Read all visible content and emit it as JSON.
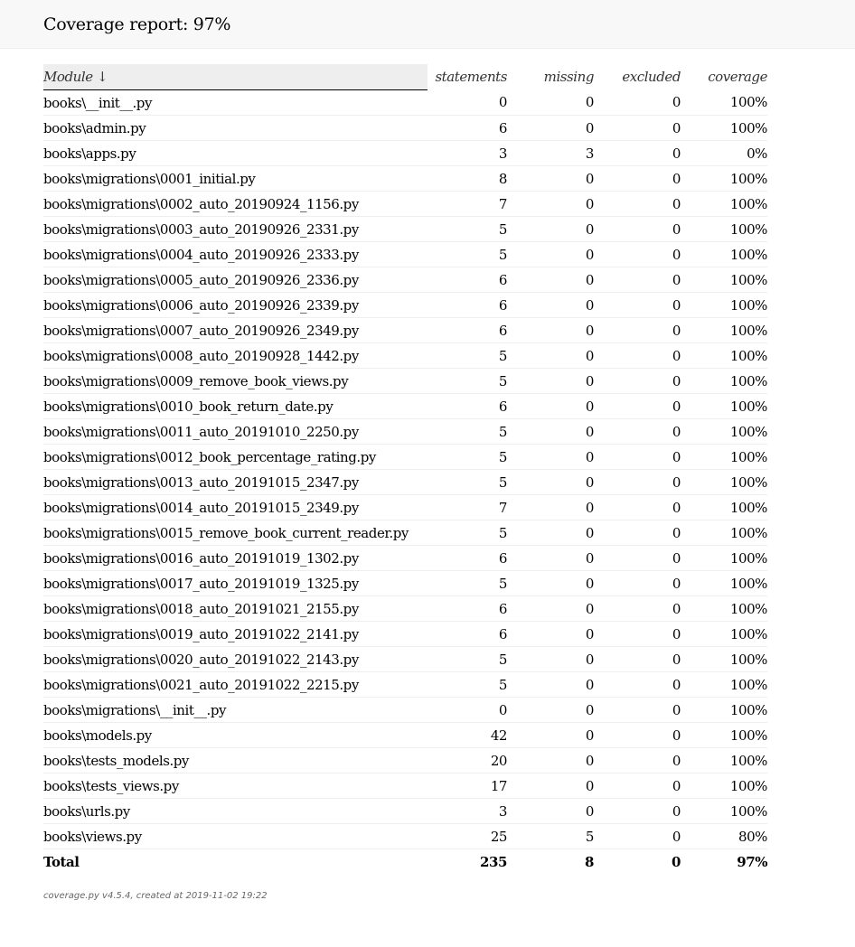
{
  "header": {
    "title": "Coverage report: 97%"
  },
  "table": {
    "columns": {
      "module": "Module ↓",
      "statements": "statements",
      "missing": "missing",
      "excluded": "excluded",
      "coverage": "coverage"
    },
    "rows": [
      {
        "module": "books\\__init__.py",
        "statements": "0",
        "missing": "0",
        "excluded": "0",
        "coverage": "100%"
      },
      {
        "module": "books\\admin.py",
        "statements": "6",
        "missing": "0",
        "excluded": "0",
        "coverage": "100%"
      },
      {
        "module": "books\\apps.py",
        "statements": "3",
        "missing": "3",
        "excluded": "0",
        "coverage": "0%"
      },
      {
        "module": "books\\migrations\\0001_initial.py",
        "statements": "8",
        "missing": "0",
        "excluded": "0",
        "coverage": "100%"
      },
      {
        "module": "books\\migrations\\0002_auto_20190924_1156.py",
        "statements": "7",
        "missing": "0",
        "excluded": "0",
        "coverage": "100%"
      },
      {
        "module": "books\\migrations\\0003_auto_20190926_2331.py",
        "statements": "5",
        "missing": "0",
        "excluded": "0",
        "coverage": "100%"
      },
      {
        "module": "books\\migrations\\0004_auto_20190926_2333.py",
        "statements": "5",
        "missing": "0",
        "excluded": "0",
        "coverage": "100%"
      },
      {
        "module": "books\\migrations\\0005_auto_20190926_2336.py",
        "statements": "6",
        "missing": "0",
        "excluded": "0",
        "coverage": "100%"
      },
      {
        "module": "books\\migrations\\0006_auto_20190926_2339.py",
        "statements": "6",
        "missing": "0",
        "excluded": "0",
        "coverage": "100%"
      },
      {
        "module": "books\\migrations\\0007_auto_20190926_2349.py",
        "statements": "6",
        "missing": "0",
        "excluded": "0",
        "coverage": "100%"
      },
      {
        "module": "books\\migrations\\0008_auto_20190928_1442.py",
        "statements": "5",
        "missing": "0",
        "excluded": "0",
        "coverage": "100%"
      },
      {
        "module": "books\\migrations\\0009_remove_book_views.py",
        "statements": "5",
        "missing": "0",
        "excluded": "0",
        "coverage": "100%"
      },
      {
        "module": "books\\migrations\\0010_book_return_date.py",
        "statements": "6",
        "missing": "0",
        "excluded": "0",
        "coverage": "100%"
      },
      {
        "module": "books\\migrations\\0011_auto_20191010_2250.py",
        "statements": "5",
        "missing": "0",
        "excluded": "0",
        "coverage": "100%"
      },
      {
        "module": "books\\migrations\\0012_book_percentage_rating.py",
        "statements": "5",
        "missing": "0",
        "excluded": "0",
        "coverage": "100%"
      },
      {
        "module": "books\\migrations\\0013_auto_20191015_2347.py",
        "statements": "5",
        "missing": "0",
        "excluded": "0",
        "coverage": "100%"
      },
      {
        "module": "books\\migrations\\0014_auto_20191015_2349.py",
        "statements": "7",
        "missing": "0",
        "excluded": "0",
        "coverage": "100%"
      },
      {
        "module": "books\\migrations\\0015_remove_book_current_reader.py",
        "statements": "5",
        "missing": "0",
        "excluded": "0",
        "coverage": "100%"
      },
      {
        "module": "books\\migrations\\0016_auto_20191019_1302.py",
        "statements": "6",
        "missing": "0",
        "excluded": "0",
        "coverage": "100%"
      },
      {
        "module": "books\\migrations\\0017_auto_20191019_1325.py",
        "statements": "5",
        "missing": "0",
        "excluded": "0",
        "coverage": "100%"
      },
      {
        "module": "books\\migrations\\0018_auto_20191021_2155.py",
        "statements": "6",
        "missing": "0",
        "excluded": "0",
        "coverage": "100%"
      },
      {
        "module": "books\\migrations\\0019_auto_20191022_2141.py",
        "statements": "6",
        "missing": "0",
        "excluded": "0",
        "coverage": "100%"
      },
      {
        "module": "books\\migrations\\0020_auto_20191022_2143.py",
        "statements": "5",
        "missing": "0",
        "excluded": "0",
        "coverage": "100%"
      },
      {
        "module": "books\\migrations\\0021_auto_20191022_2215.py",
        "statements": "5",
        "missing": "0",
        "excluded": "0",
        "coverage": "100%"
      },
      {
        "module": "books\\migrations\\__init__.py",
        "statements": "0",
        "missing": "0",
        "excluded": "0",
        "coverage": "100%"
      },
      {
        "module": "books\\models.py",
        "statements": "42",
        "missing": "0",
        "excluded": "0",
        "coverage": "100%"
      },
      {
        "module": "books\\tests_models.py",
        "statements": "20",
        "missing": "0",
        "excluded": "0",
        "coverage": "100%"
      },
      {
        "module": "books\\tests_views.py",
        "statements": "17",
        "missing": "0",
        "excluded": "0",
        "coverage": "100%"
      },
      {
        "module": "books\\urls.py",
        "statements": "3",
        "missing": "0",
        "excluded": "0",
        "coverage": "100%"
      },
      {
        "module": "books\\views.py",
        "statements": "25",
        "missing": "5",
        "excluded": "0",
        "coverage": "80%"
      }
    ],
    "total": {
      "module": "Total",
      "statements": "235",
      "missing": "8",
      "excluded": "0",
      "coverage": "97%"
    }
  },
  "footer": {
    "text": "coverage.py v4.5.4, created at 2019-11-02 19:22"
  }
}
